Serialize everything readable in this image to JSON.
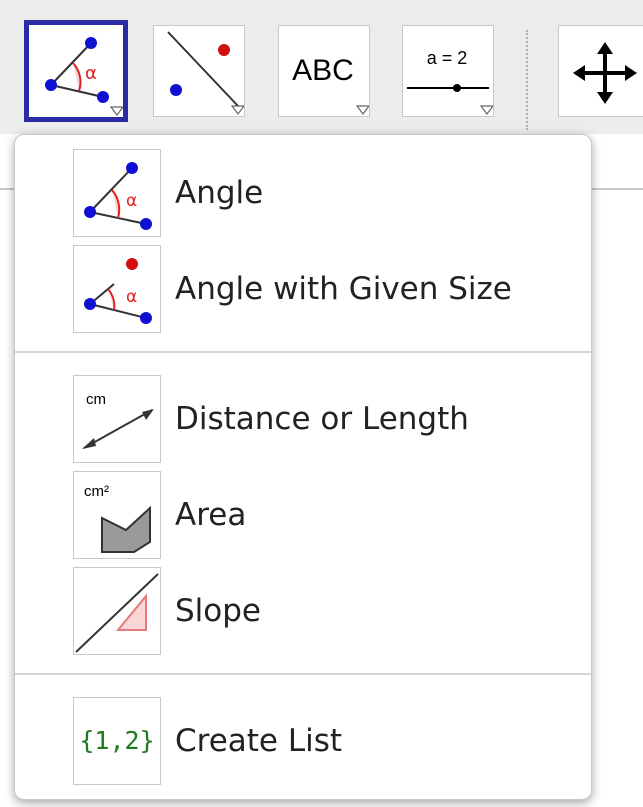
{
  "toolbar": {
    "tools": [
      {
        "name": "angle-tool",
        "selected": true,
        "icon": "angle-icon"
      },
      {
        "name": "perpendicular-line-tool",
        "selected": false,
        "icon": "point-line-icon"
      },
      {
        "name": "text-tool",
        "selected": false,
        "icon": "text-icon",
        "text": "ABC"
      },
      {
        "name": "slider-tool",
        "selected": false,
        "icon": "slider-icon",
        "text": "a = 2"
      },
      {
        "name": "move-graphics-view-tool",
        "selected": false,
        "icon": "move-arrows-icon"
      }
    ]
  },
  "menu": {
    "items": [
      {
        "label": "Angle",
        "icon": "angle-icon"
      },
      {
        "label": "Angle with Given Size",
        "icon": "angle-given-size-icon"
      },
      {
        "label": "Distance or Length",
        "icon": "distance-icon",
        "icon_text": "cm"
      },
      {
        "label": "Area",
        "icon": "area-icon",
        "icon_text": "cm²"
      },
      {
        "label": "Slope",
        "icon": "slope-icon"
      },
      {
        "label": "Create List",
        "icon": "list-icon",
        "icon_text": "{1,2}"
      }
    ]
  },
  "colors": {
    "selected_border": "#2b2ba6",
    "point_blue": "#1010d0",
    "point_red": "#d01010",
    "angle_red": "#e02020",
    "list_green": "#1e7a1e"
  }
}
